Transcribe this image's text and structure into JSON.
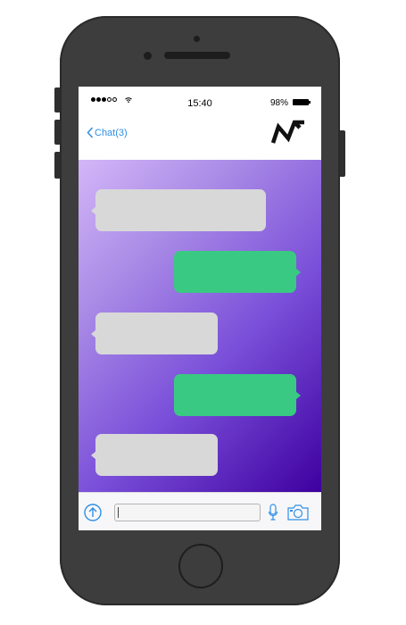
{
  "status_bar": {
    "time": "15:40",
    "battery_percent": "98%",
    "signal_strength_dots": 3,
    "signal_total_dots": 5
  },
  "nav": {
    "back_label": "Chat(3)",
    "logo_icon": "brand-logo-icon"
  },
  "chat": {
    "messages": [
      {
        "direction": "incoming",
        "text": ""
      },
      {
        "direction": "outgoing",
        "text": ""
      },
      {
        "direction": "incoming",
        "text": ""
      },
      {
        "direction": "outgoing",
        "text": ""
      },
      {
        "direction": "incoming",
        "text": ""
      }
    ]
  },
  "composer": {
    "value": "",
    "send_icon": "arrow-up-circle-icon",
    "mic_icon": "microphone-icon",
    "camera_icon": "camera-icon"
  },
  "colors": {
    "accent": "#2f8fe5",
    "incoming_bubble": "#d8d8d8",
    "outgoing_bubble": "#3ac982",
    "gradient_start": "#d3b6f8",
    "gradient_end": "#3e00a0"
  }
}
